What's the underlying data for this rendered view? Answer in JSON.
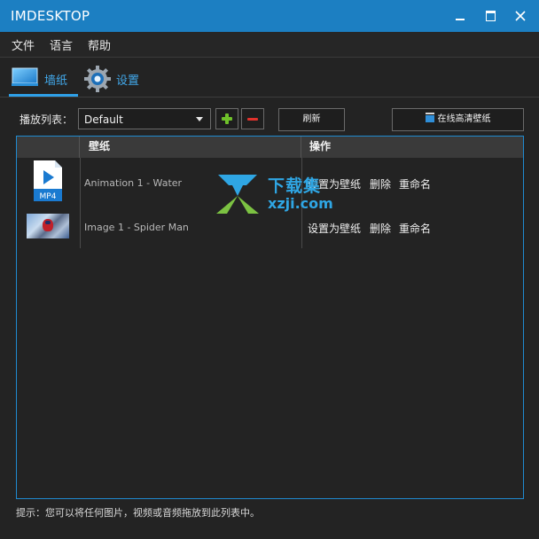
{
  "window": {
    "title": "IMDESKTOP",
    "min_label": "–",
    "max_label": "□",
    "close_label": "✕"
  },
  "menu": {
    "items": [
      "文件",
      "语言",
      "帮助"
    ]
  },
  "tabs": [
    {
      "label": "墙纸",
      "icon": "monitor-icon",
      "active": true
    },
    {
      "label": "设置",
      "icon": "gear-icon",
      "active": false
    }
  ],
  "toolbar": {
    "playlist_label": "播放列表：",
    "playlist_value": "Default",
    "add_icon": "plus-icon",
    "remove_icon": "minus-icon",
    "refresh_label": "刷新",
    "online_label": "在线高清壁纸"
  },
  "list": {
    "columns": [
      "",
      "壁纸",
      "操作"
    ],
    "rows": [
      {
        "thumb": "mp4-file-icon",
        "thumb_label": "MP4",
        "name": "Animation 1 - Water",
        "actions": [
          "设置为壁纸",
          "删除",
          "重命名"
        ]
      },
      {
        "thumb": "image-thumbnail",
        "name": "Image 1 - Spider Man",
        "actions": [
          "设置为壁纸",
          "删除",
          "重命名"
        ]
      }
    ]
  },
  "watermark": {
    "line1": "下载集",
    "line2": "xzji.com"
  },
  "footer": {
    "hint": "提示：您可以将任何图片，视频或音频拖放到此列表中。"
  },
  "colors": {
    "titlebar": "#1c7fc2",
    "accent": "#42a8ea",
    "background": "#232323",
    "add": "#6fc12a",
    "remove": "#e0322c"
  }
}
